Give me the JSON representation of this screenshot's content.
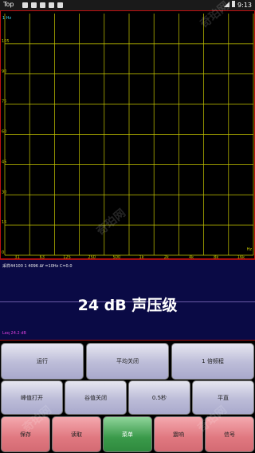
{
  "status_bar": {
    "left": "Top",
    "time": "9:13"
  },
  "chart": {
    "peak_label": "1 Hz",
    "y_ticks": [
      "105",
      "90",
      "75",
      "60",
      "45",
      "30",
      "15",
      "0"
    ],
    "x_ticks": [
      "31",
      "63",
      "125",
      "250",
      "500",
      "1k",
      "2k",
      "4k",
      "8k",
      "16k"
    ],
    "x_unit": "Hz"
  },
  "chart_data": {
    "type": "line",
    "ylim": [
      0,
      120
    ],
    "y_ticks": [
      0,
      15,
      30,
      45,
      60,
      75,
      90,
      105
    ],
    "x_ticks": [
      "31",
      "63",
      "125",
      "250",
      "500",
      "1k",
      "2k",
      "4k",
      "8k",
      "16k"
    ],
    "series": [],
    "grid": true
  },
  "readout": {
    "info": "采样44100 1 4096 Δf =10Hz C=0.0",
    "level": "24 dB 声压级",
    "leq": "Leq 24.2 dB"
  },
  "buttons": {
    "run": "运行",
    "avg_off": "平均关闭",
    "octave": "1  倍频程",
    "peak_on": "峰值打开",
    "valley_off": "谷值关闭",
    "interval": "0.5秒",
    "weighting": "平直",
    "save": "保存",
    "read": "读取",
    "menu": "菜单",
    "ambient": "震响",
    "signal": "信号"
  },
  "colors": {
    "grid": "#c8c800",
    "chart_border": "#c01010",
    "readout_bg": "#0a0a45",
    "button_grey": "#bcbcd8",
    "button_pink": "#e07880",
    "button_green": "#3a9a4a"
  },
  "watermark": "奇珀网"
}
